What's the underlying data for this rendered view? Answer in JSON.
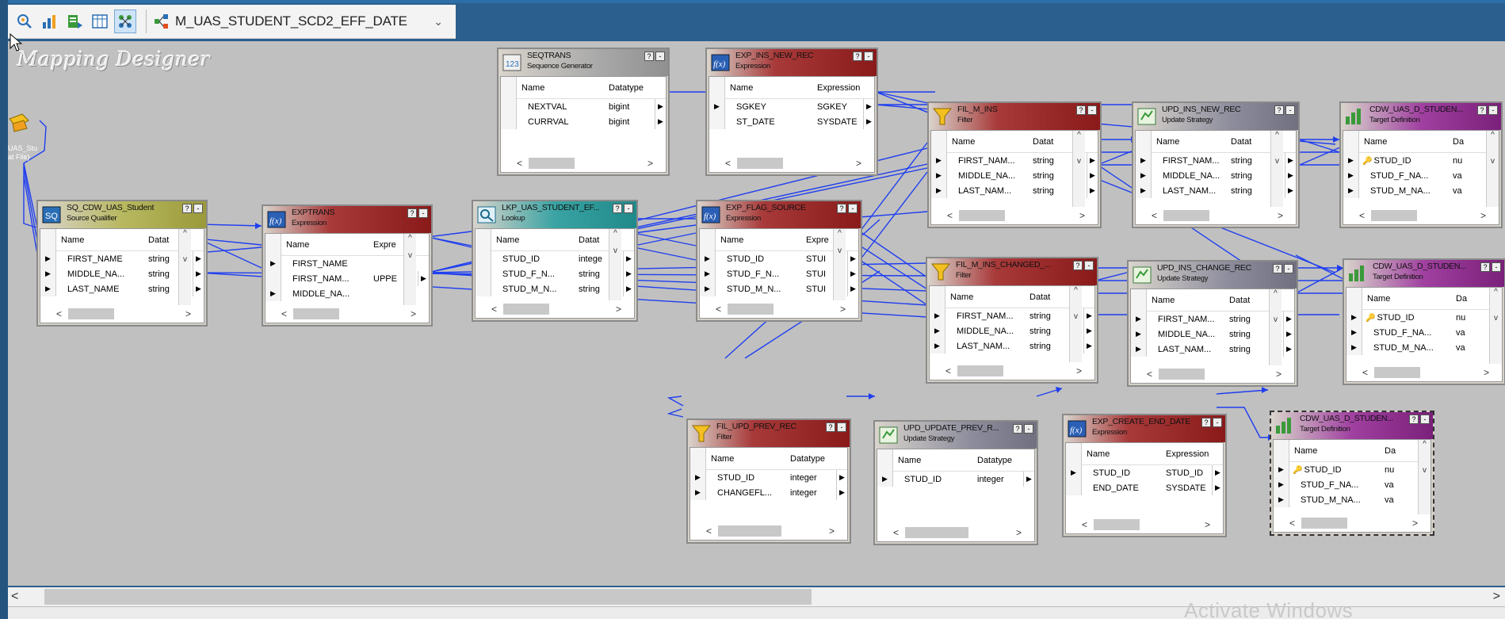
{
  "toolbar": {
    "mapping_name": "M_UAS_STUDENT_SCD2_EFF_DATE",
    "icons": [
      "source-analyzer-icon",
      "target-designer-icon",
      "transformation-developer-icon",
      "mapplet-designer-icon",
      "mapping-designer-icon"
    ]
  },
  "canvas": {
    "title": "Mapping Designer",
    "source_label_line1": "UAS_Stu",
    "source_label_line2": "at File)"
  },
  "nodes": {
    "seqtrans": {
      "name": "SEQTRANS",
      "type": "Sequence Generator",
      "col1": "Name",
      "col2": "Datatype",
      "rows": [
        {
          "name": "NEXTVAL",
          "type": "bigint"
        },
        {
          "name": "CURRVAL",
          "type": "bigint"
        }
      ]
    },
    "exp_ins_new": {
      "name": "EXP_INS_NEW_REC",
      "type": "Expression",
      "col1": "Name",
      "col2": "Expression",
      "rows": [
        {
          "name": "SGKEY",
          "type": "SGKEY"
        },
        {
          "name": "ST_DATE",
          "type": "SYSDATE"
        }
      ]
    },
    "fil_m_ins": {
      "name": "FIL_M_INS",
      "type": "Filter",
      "col1": "Name",
      "col2": "Datat",
      "rows": [
        {
          "name": "FIRST_NAM...",
          "type": "string"
        },
        {
          "name": "MIDDLE_NA...",
          "type": "string"
        },
        {
          "name": "LAST_NAM...",
          "type": "string"
        }
      ]
    },
    "upd_ins_new": {
      "name": "UPD_INS_NEW_REC",
      "type": "Update Strategy",
      "col1": "Name",
      "col2": "Datat",
      "rows": [
        {
          "name": "FIRST_NAM...",
          "type": "string"
        },
        {
          "name": "MIDDLE_NA...",
          "type": "string"
        },
        {
          "name": "LAST_NAM...",
          "type": "string"
        }
      ]
    },
    "tgt1": {
      "name": "CDW_UAS_D_STUDEN...",
      "type": "Target Definition",
      "col1": "Name",
      "col2": "Da",
      "rows": [
        {
          "name": "STUD_ID",
          "type": "nu",
          "key": true
        },
        {
          "name": "STUD_F_NA...",
          "type": "va"
        },
        {
          "name": "STUD_M_NA...",
          "type": "va"
        }
      ]
    },
    "sq": {
      "name": "SQ_CDW_UAS_Student",
      "type": "Source Qualifier",
      "col1": "Name",
      "col2": "Datat",
      "rows": [
        {
          "name": "FIRST_NAME",
          "type": "string"
        },
        {
          "name": "MIDDLE_NA...",
          "type": "string"
        },
        {
          "name": "LAST_NAME",
          "type": "string"
        }
      ]
    },
    "exptrans": {
      "name": "EXPTRANS",
      "type": "Expression",
      "col1": "Name",
      "col2": "Expre",
      "rows": [
        {
          "name": "FIRST_NAME",
          "type": ""
        },
        {
          "name": "FIRST_NAM...",
          "type": "UPPE"
        },
        {
          "name": "MIDDLE_NA...",
          "type": ""
        }
      ]
    },
    "lkp": {
      "name": "LKP_UAS_STUDENT_EF...",
      "type": "Lookup",
      "col1": "Name",
      "col2": "Datat",
      "rows": [
        {
          "name": "STUD_ID",
          "type": "intege"
        },
        {
          "name": "STUD_F_N...",
          "type": "string"
        },
        {
          "name": "STUD_M_N...",
          "type": "string"
        }
      ]
    },
    "exp_flag": {
      "name": "EXP_FLAG_SOURCE",
      "type": "Expression",
      "col1": "Name",
      "col2": "Expre",
      "rows": [
        {
          "name": "STUD_ID",
          "type": "STUI"
        },
        {
          "name": "STUD_F_N...",
          "type": "STUI"
        },
        {
          "name": "STUD_M_N...",
          "type": "STUI"
        }
      ]
    },
    "fil_changed": {
      "name": "FIL_M_INS_CHANGED_...",
      "type": "Filter",
      "col1": "Name",
      "col2": "Datat",
      "rows": [
        {
          "name": "FIRST_NAM...",
          "type": "string"
        },
        {
          "name": "MIDDLE_NA...",
          "type": "string"
        },
        {
          "name": "LAST_NAM...",
          "type": "string"
        }
      ]
    },
    "upd_ins_change": {
      "name": "UPD_INS_CHANGE_REC",
      "type": "Update Strategy",
      "col1": "Name",
      "col2": "Datat",
      "rows": [
        {
          "name": "FIRST_NAM...",
          "type": "string"
        },
        {
          "name": "MIDDLE_NA...",
          "type": "string"
        },
        {
          "name": "LAST_NAM...",
          "type": "string"
        }
      ]
    },
    "tgt2": {
      "name": "CDW_UAS_D_STUDEN...",
      "type": "Target Definition",
      "col1": "Name",
      "col2": "Da",
      "rows": [
        {
          "name": "STUD_ID",
          "type": "nu",
          "key": true
        },
        {
          "name": "STUD_F_NA...",
          "type": "va"
        },
        {
          "name": "STUD_M_NA...",
          "type": "va"
        }
      ]
    },
    "fil_upd_prev": {
      "name": "FIL_UPD_PREV_REC",
      "type": "Filter",
      "col1": "Name",
      "col2": "Datatype",
      "rows": [
        {
          "name": "STUD_ID",
          "type": "integer"
        },
        {
          "name": "CHANGEFL...",
          "type": "integer"
        }
      ]
    },
    "upd_update_prev": {
      "name": "UPD_UPDATE_PREV_R...",
      "type": "Update Strategy",
      "col1": "Name",
      "col2": "Datatype",
      "rows": [
        {
          "name": "STUD_ID",
          "type": "integer"
        }
      ]
    },
    "exp_create_end": {
      "name": "EXP_CREATE_END_DATE",
      "type": "Expression",
      "col1": "Name",
      "col2": "Expression",
      "rows": [
        {
          "name": "STUD_ID",
          "type": "STUD_ID"
        },
        {
          "name": "END_DATE",
          "type": "SYSDATE"
        }
      ]
    },
    "tgt3": {
      "name": "CDW_UAS_D_STUDEN...",
      "type": "Target Definition",
      "col1": "Name",
      "col2": "Da",
      "rows": [
        {
          "name": "STUD_ID",
          "type": "nu",
          "key": true
        },
        {
          "name": "STUD_F_NA...",
          "type": "va"
        },
        {
          "name": "STUD_M_NA...",
          "type": "va"
        }
      ]
    }
  },
  "watermark": "Activate Windows",
  "colors": {
    "link": "#1f3ef0",
    "canvas": "#c0c0c0",
    "expression": "#8a1a1a",
    "target": "#7a207a",
    "lookup": "#208a8a"
  }
}
